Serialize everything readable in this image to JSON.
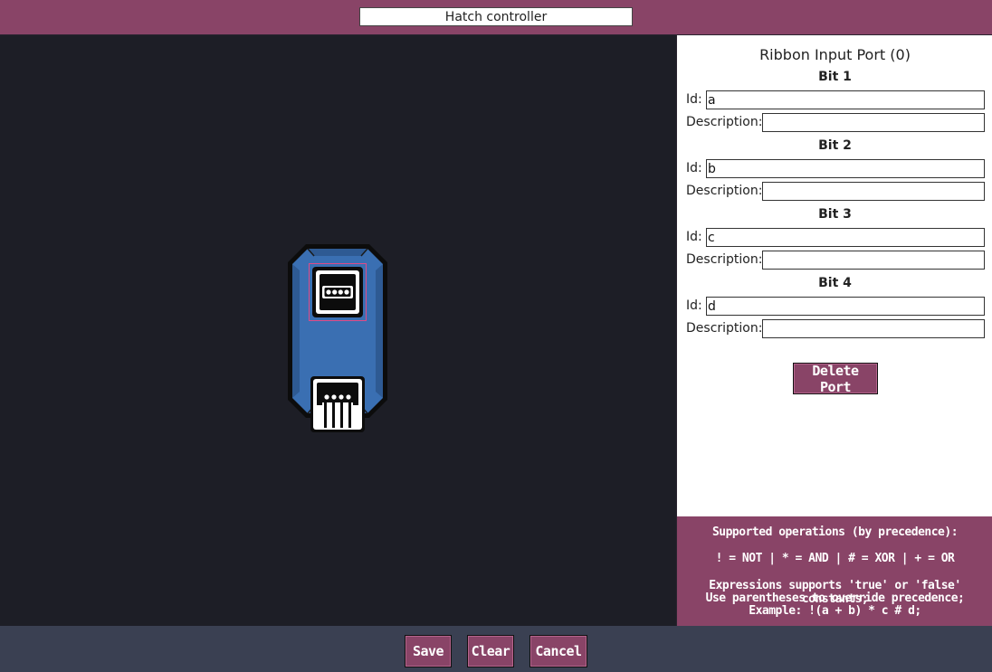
{
  "header": {
    "title_value": "Hatch controller"
  },
  "panel": {
    "title": "Ribbon Input Port (0)",
    "id_label": "Id:",
    "description_label": "Description:",
    "bits": [
      {
        "heading": "Bit 1",
        "id": "a",
        "description": ""
      },
      {
        "heading": "Bit 2",
        "id": "b",
        "description": ""
      },
      {
        "heading": "Bit 3",
        "id": "c",
        "description": ""
      },
      {
        "heading": "Bit 4",
        "id": "d",
        "description": ""
      }
    ],
    "delete_label": "Delete Port"
  },
  "help": {
    "line1": "Supported operations (by precedence):",
    "line2": "! = NOT | * = AND | # = XOR | + = OR",
    "line3": "Expressions supports 'true' or 'false' constants;",
    "line4": "Use parentheses to override precedence;",
    "line5": "Example: !(a + b) * c # d;"
  },
  "footer": {
    "save_label": "Save",
    "clear_label": "Clear",
    "cancel_label": "Cancel"
  },
  "colors": {
    "accent": "#894467",
    "background": "#1d1e26",
    "bottom_bar": "#3a4052",
    "device_body": "#3a6fb2",
    "selection": "#e04a86"
  },
  "icons": {
    "device": "circuit-device-icon",
    "input_port": "ribbon-input-port-icon",
    "output_port": "ribbon-output-port-icon"
  }
}
